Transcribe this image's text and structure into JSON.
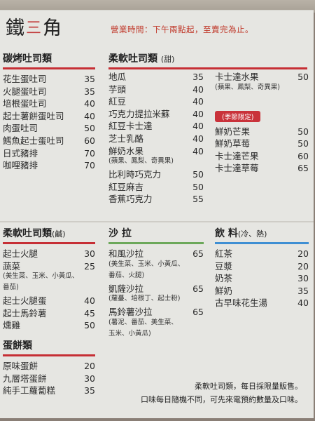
{
  "header": {
    "logo_left": "鐵",
    "logo_mark": "三",
    "logo_right": "角",
    "hours": "營業時間：下午兩點起，至賣完為止。"
  },
  "sections": {
    "charcoal_toast": {
      "title": "碳烤吐司類",
      "items": [
        {
          "name": "花生蛋吐司",
          "price": "35"
        },
        {
          "name": "火腿蛋吐司",
          "price": "35"
        },
        {
          "name": "培根蛋吐司",
          "price": "40"
        },
        {
          "name": "起士薯餅蛋吐司",
          "price": "40"
        },
        {
          "name": "肉蛋吐司",
          "price": "50"
        },
        {
          "name": "鱈魚起士蛋吐司",
          "price": "60"
        },
        {
          "name": "日式豬排",
          "price": "70"
        },
        {
          "name": "咖哩豬排",
          "price": "70"
        }
      ]
    },
    "soft_toast_sweet": {
      "title": "柔軟吐司類",
      "subtitle": "(甜)",
      "col1": [
        {
          "name": "地瓜",
          "price": "35"
        },
        {
          "name": "芋頭",
          "price": "40"
        },
        {
          "name": "紅豆",
          "price": "40"
        },
        {
          "name": "巧克力提拉米蘇",
          "price": "40"
        },
        {
          "name": "紅豆卡士達",
          "price": "40"
        },
        {
          "name": "芝士乳酪",
          "price": "40"
        },
        {
          "name": "鮮奶水果",
          "price": "40"
        },
        {
          "note": "(蘋果、鳳梨、奇異果)"
        },
        {
          "name": "比利時巧克力",
          "price": "50"
        },
        {
          "name": "紅豆麻吉",
          "price": "50"
        },
        {
          "name": "香蕉巧克力",
          "price": "55"
        }
      ],
      "col2": [
        {
          "name": "卡士達水果",
          "price": "50"
        },
        {
          "note": "(蘋果、鳳梨、奇異果)"
        }
      ],
      "seasonal_label": "(季節限定)",
      "seasonal_items": [
        {
          "name": "鮮奶芒果",
          "price": "50"
        },
        {
          "name": "鮮奶草莓",
          "price": "50"
        },
        {
          "name": "卡士達芒果",
          "price": "60"
        },
        {
          "name": "卡士達草莓",
          "price": "65"
        }
      ]
    },
    "soft_toast_salty": {
      "title": "柔軟吐司類",
      "subtitle": "(鹹)",
      "items": [
        {
          "name": "起士火腿",
          "price": "30"
        },
        {
          "name": "蔬菜",
          "price": "25"
        },
        {
          "note": "(美生菜、玉米、小黃瓜、"
        },
        {
          "note": "番茄)"
        },
        {
          "name": "起士火腿蛋",
          "price": "40"
        },
        {
          "name": "起士馬鈴薯",
          "price": "45"
        },
        {
          "name": "燻雞",
          "price": "50"
        }
      ]
    },
    "salad": {
      "title": "沙 拉",
      "items": [
        {
          "name": "和風沙拉",
          "price": "65"
        },
        {
          "note": "(美生菜、玉米、小黃瓜、"
        },
        {
          "note": "番茄、火腿)"
        },
        {
          "name": "凱薩沙拉",
          "price": "65"
        },
        {
          "note": "(蘿蔓、培根丁、起士粉)"
        },
        {
          "name": "馬鈴薯沙拉",
          "price": "65"
        },
        {
          "note": "(薯泥、番茄、美生菜、"
        },
        {
          "note": "玉米、小黃瓜)"
        }
      ]
    },
    "drinks": {
      "title": "飲 料",
      "subtitle": "(冷、熱)",
      "items": [
        {
          "name": "紅茶",
          "price": "20"
        },
        {
          "name": "豆漿",
          "price": "20"
        },
        {
          "name": "奶茶",
          "price": "30"
        },
        {
          "name": "鮮奶",
          "price": "35"
        },
        {
          "name": "古早味花生湯",
          "price": "40"
        }
      ]
    },
    "egg_pancake": {
      "title": "蛋餅類",
      "items": [
        {
          "name": "原味蛋餅",
          "price": "20"
        },
        {
          "name": "九層塔蛋餅",
          "price": "30"
        },
        {
          "name": "純手工蘿蔔糕",
          "price": "35"
        }
      ]
    }
  },
  "footer": {
    "line1": "柔軟吐司類，每日採限量販售。",
    "line2": "口味每日隨機不同，可先來電預約數量及口味。"
  },
  "colors": {
    "accent_red": "#c62f35",
    "salad_green": "#6ca85a",
    "drinks_blue": "#3f8fd3",
    "paper": "#e6e6e2"
  }
}
